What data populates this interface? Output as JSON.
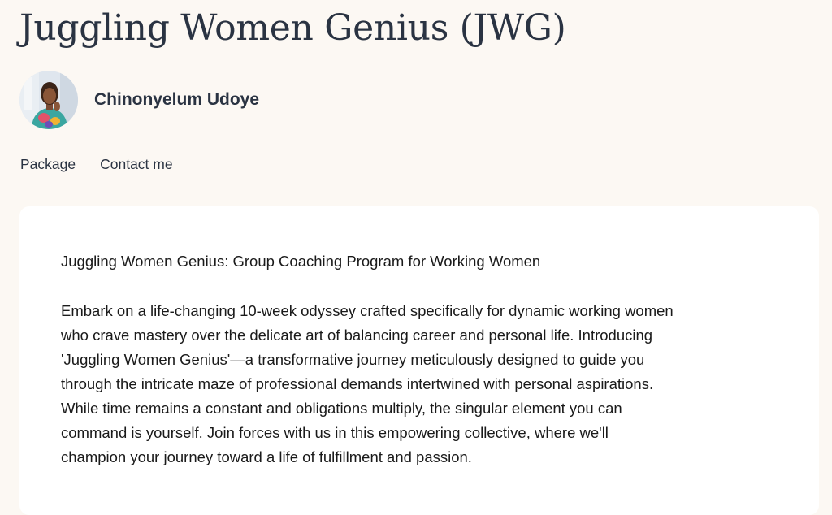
{
  "page": {
    "title": "Juggling Women Genius (JWG)"
  },
  "author": {
    "name": "Chinonyelum Udoye",
    "avatar_icon": "profile-photo"
  },
  "nav": {
    "items": [
      {
        "label": "Package"
      },
      {
        "label": "Contact me"
      }
    ]
  },
  "content": {
    "heading": "Juggling Women Genius: Group Coaching Program for Working Women",
    "paragraph_lines": [
      "Embark on a life-changing 10-week odyssey crafted specifically for dynamic working women",
      "who crave mastery over the delicate art of balancing career and personal life. Introducing",
      "'Juggling Women Genius'—a transformative journey meticulously designed to guide you",
      "through the intricate maze of professional demands intertwined with personal aspirations.",
      "While time remains a constant and obligations multiply, the singular element you can",
      "command is yourself. Join forces with us in this empowering collective, where we'll",
      "champion your journey toward a life of fulfillment and passion."
    ]
  },
  "colors": {
    "background": "#fcf8f3",
    "card": "#ffffff",
    "text": "#2a3342"
  }
}
